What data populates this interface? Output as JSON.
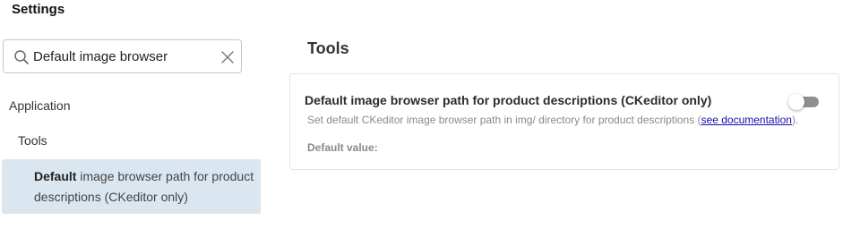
{
  "header": {
    "title": "Settings"
  },
  "search": {
    "value": "Default image browser",
    "placeholder": ""
  },
  "sidebar": {
    "group": "Application",
    "section": "Tools",
    "result": {
      "bold": "Default",
      "rest": " image browser path for product descriptions (CKeditor only)"
    }
  },
  "main": {
    "section_title": "Tools",
    "setting": {
      "title": "Default image browser path for product descriptions (CKeditor only)",
      "description_before": "Set default CKeditor image browser path in img/ directory for product descriptions (",
      "link": "see documentation",
      "description_after": ").",
      "default_label": "Default value:",
      "enabled": false
    }
  }
}
